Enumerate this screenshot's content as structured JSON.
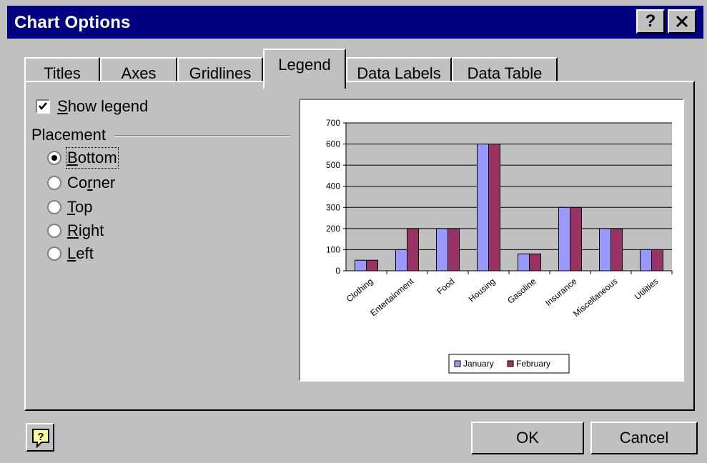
{
  "window": {
    "title": "Chart Options",
    "help_glyph": "?",
    "close_glyph": "✕"
  },
  "tabs": [
    {
      "label": "Titles",
      "active": false
    },
    {
      "label": "Axes",
      "active": false
    },
    {
      "label": "Gridlines",
      "active": false
    },
    {
      "label": "Legend",
      "active": true
    },
    {
      "label": "Data Labels",
      "active": false
    },
    {
      "label": "Data Table",
      "active": false
    }
  ],
  "legend_options": {
    "show_legend": {
      "label_prefix": "",
      "label_access": "S",
      "label_rest": "how legend",
      "checked": true
    },
    "placement_label": "Placement",
    "placements": [
      {
        "pre": "",
        "access": "B",
        "post": "ottom",
        "selected": true
      },
      {
        "pre": "Co",
        "access": "r",
        "post": "ner",
        "selected": false
      },
      {
        "pre": "",
        "access": "T",
        "post": "op",
        "selected": false
      },
      {
        "pre": "",
        "access": "R",
        "post": "ight",
        "selected": false
      },
      {
        "pre": "",
        "access": "L",
        "post": "eft",
        "selected": false
      }
    ]
  },
  "buttons": {
    "ok": "OK",
    "cancel": "Cancel",
    "help_icon": "help-balloon-icon"
  },
  "colors": {
    "title_bar": "#000080",
    "january": "#9999ff",
    "february": "#993366",
    "plot_area": "#c0c0c0"
  },
  "chart_data": {
    "type": "bar",
    "categories": [
      "Clothing",
      "Entertainment",
      "Food",
      "Housing",
      "Gasoline",
      "Insurance",
      "Miscellaneous",
      "Utilities"
    ],
    "series": [
      {
        "name": "January",
        "values": [
          50,
          100,
          200,
          600,
          80,
          300,
          200,
          100
        ]
      },
      {
        "name": "February",
        "values": [
          50,
          200,
          200,
          600,
          80,
          300,
          200,
          100
        ]
      }
    ],
    "ylim": [
      0,
      700
    ],
    "yticks": [
      "0",
      "100",
      "200",
      "300",
      "400",
      "500",
      "600",
      "700"
    ],
    "grid": true,
    "legend_placement": "bottom"
  }
}
